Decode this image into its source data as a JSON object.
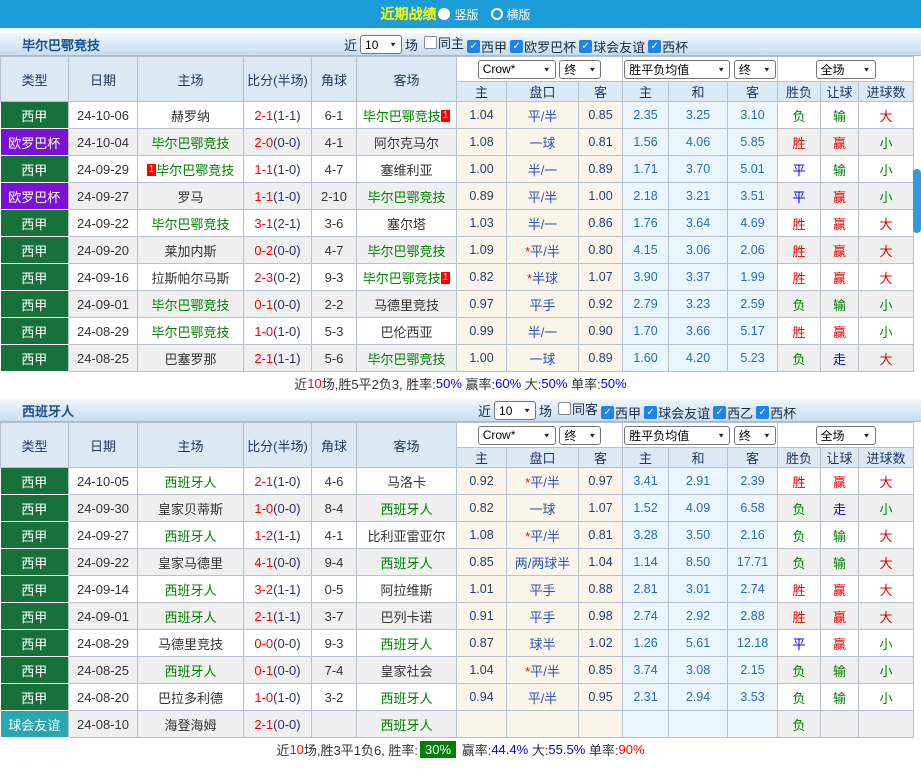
{
  "topbar": {
    "title": "近期战绩",
    "vertical_label": "竖版",
    "horizontal_label": "横版"
  },
  "columns": {
    "type": "类型",
    "date": "日期",
    "home": "主场",
    "score": "比分(半场)",
    "corner": "角球",
    "away": "客场",
    "odds_home": "主",
    "handicap": "盘口",
    "odds_away": "客",
    "mean_home": "主",
    "mean_draw": "和",
    "mean_away": "客",
    "result": "胜负",
    "handicap_result": "让球",
    "goals": "进球数"
  },
  "colors": {
    "topbar": "#1d9cd8",
    "types": {
      "西甲": "#17713a",
      "欧罗巴杯": "#7a12d4",
      "球会友谊": "#29a7ae"
    },
    "focus_team": "#008000",
    "score": "#ff0000",
    "result_map": {
      "胜": "#e60000",
      "负": "#008000",
      "平": "#0000e6",
      "赢": "#e60000",
      "输": "#008000",
      "走": "#0000e6",
      "大": "#e60000",
      "小": "#008000"
    }
  },
  "sections": [
    {
      "team": "毕尔巴鄂竞技",
      "filter": {
        "near_label": "近",
        "games": "10",
        "games_label": "场",
        "checkboxes": [
          {
            "label": "同主",
            "checked": false
          },
          {
            "label": "西甲",
            "checked": true
          },
          {
            "label": "欧罗巴杯",
            "checked": true
          },
          {
            "label": "球会友谊",
            "checked": true
          },
          {
            "label": "西杯",
            "checked": true
          }
        ]
      },
      "selects": {
        "odds": "Crow*",
        "odds_state": "终",
        "mean": "胜平负均值",
        "mean_state": "终",
        "scope": "全场"
      },
      "rows": [
        {
          "type": "西甲",
          "date": "24-10-06",
          "home": {
            "name": "赫罗纳",
            "focus": false
          },
          "score": "2-1",
          "half": "(1-1)",
          "corner": "6-1",
          "away": {
            "name": "毕尔巴鄂竞技",
            "focus": true,
            "badge_right": "1"
          },
          "odds": [
            "1.04",
            "平/半",
            "0.85"
          ],
          "mean": [
            "2.35",
            "3.25",
            "3.10"
          ],
          "results": [
            "负",
            "输",
            "大"
          ]
        },
        {
          "type": "欧罗巴杯",
          "date": "24-10-04",
          "home": {
            "name": "毕尔巴鄂竞技",
            "focus": true
          },
          "score": "2-0",
          "half": "(0-0)",
          "corner": "4-1",
          "away": {
            "name": "阿尔克马尔",
            "focus": false
          },
          "odds": [
            "1.08",
            "一球",
            "0.81"
          ],
          "mean": [
            "1.56",
            "4.06",
            "5.85"
          ],
          "results": [
            "胜",
            "赢",
            "小"
          ]
        },
        {
          "type": "西甲",
          "date": "24-09-29",
          "home": {
            "name": "毕尔巴鄂竞技",
            "focus": true,
            "badge_left": "1"
          },
          "score": "1-1",
          "half": "(1-0)",
          "corner": "4-7",
          "away": {
            "name": "塞维利亚",
            "focus": false
          },
          "odds": [
            "1.00",
            "半/一",
            "0.89"
          ],
          "mean": [
            "1.71",
            "3.70",
            "5.01"
          ],
          "results": [
            "平",
            "输",
            "小"
          ]
        },
        {
          "type": "欧罗巴杯",
          "date": "24-09-27",
          "home": {
            "name": "罗马",
            "focus": false
          },
          "score": "1-1",
          "half": "(1-0)",
          "corner": "2-10",
          "away": {
            "name": "毕尔巴鄂竞技",
            "focus": true
          },
          "odds": [
            "0.89",
            "平/半",
            "1.00"
          ],
          "mean": [
            "2.18",
            "3.21",
            "3.51"
          ],
          "results": [
            "平",
            "赢",
            "小"
          ]
        },
        {
          "type": "西甲",
          "date": "24-09-22",
          "home": {
            "name": "毕尔巴鄂竞技",
            "focus": true
          },
          "score": "3-1",
          "half": "(2-1)",
          "corner": "3-6",
          "away": {
            "name": "塞尔塔",
            "focus": false
          },
          "odds": [
            "1.03",
            "半/一",
            "0.86"
          ],
          "mean": [
            "1.76",
            "3.64",
            "4.69"
          ],
          "results": [
            "胜",
            "赢",
            "大"
          ]
        },
        {
          "type": "西甲",
          "date": "24-09-20",
          "home": {
            "name": "莱加内斯",
            "focus": false
          },
          "score": "0-2",
          "half": "(0-0)",
          "corner": "4-7",
          "away": {
            "name": "毕尔巴鄂竞技",
            "focus": true
          },
          "odds": [
            "1.09",
            "*平/半",
            "0.80"
          ],
          "mean": [
            "4.15",
            "3.06",
            "2.06"
          ],
          "results": [
            "胜",
            "赢",
            "大"
          ]
        },
        {
          "type": "西甲",
          "date": "24-09-16",
          "home": {
            "name": "拉斯帕尔马斯",
            "focus": false
          },
          "score": "2-3",
          "half": "(0-2)",
          "corner": "9-3",
          "away": {
            "name": "毕尔巴鄂竞技",
            "focus": true,
            "badge_right": "1"
          },
          "odds": [
            "0.82",
            "*半球",
            "1.07"
          ],
          "mean": [
            "3.90",
            "3.37",
            "1.99"
          ],
          "results": [
            "胜",
            "赢",
            "大"
          ]
        },
        {
          "type": "西甲",
          "date": "24-09-01",
          "home": {
            "name": "毕尔巴鄂竞技",
            "focus": true
          },
          "score": "0-1",
          "half": "(0-0)",
          "corner": "2-2",
          "away": {
            "name": "马德里竞技",
            "focus": false
          },
          "odds": [
            "0.97",
            "平手",
            "0.92"
          ],
          "mean": [
            "2.79",
            "3.23",
            "2.59"
          ],
          "results": [
            "负",
            "输",
            "小"
          ]
        },
        {
          "type": "西甲",
          "date": "24-08-29",
          "home": {
            "name": "毕尔巴鄂竞技",
            "focus": true
          },
          "score": "1-0",
          "half": "(1-0)",
          "corner": "5-3",
          "away": {
            "name": "巴伦西亚",
            "focus": false
          },
          "odds": [
            "0.99",
            "半/一",
            "0.90"
          ],
          "mean": [
            "1.70",
            "3.66",
            "5.17"
          ],
          "results": [
            "胜",
            "赢",
            "小"
          ]
        },
        {
          "type": "西甲",
          "date": "24-08-25",
          "home": {
            "name": "巴塞罗那",
            "focus": false
          },
          "score": "2-1",
          "half": "(1-1)",
          "corner": "5-6",
          "away": {
            "name": "毕尔巴鄂竞技",
            "focus": true
          },
          "odds": [
            "1.00",
            "一球",
            "0.89"
          ],
          "mean": [
            "1.60",
            "4.20",
            "5.23"
          ],
          "results": [
            "负",
            "走",
            "大"
          ]
        }
      ],
      "summary": [
        {
          "text": "近",
          "color": "#333333"
        },
        {
          "text": "10",
          "color": "#ff0000"
        },
        {
          "text": "场,胜5平2负3, 胜率:",
          "color": "#333333"
        },
        {
          "text": "50%",
          "color": "#0000ee"
        },
        {
          "text": " 赢率:",
          "color": "#333333"
        },
        {
          "text": "60%",
          "color": "#0000ee"
        },
        {
          "text": " 大:",
          "color": "#333333"
        },
        {
          "text": "50%",
          "color": "#0000ee"
        },
        {
          "text": " 单率:",
          "color": "#333333"
        },
        {
          "text": "50%",
          "color": "#0000ee"
        }
      ]
    },
    {
      "team": "西班牙人",
      "filter": {
        "near_label": "近",
        "games": "10",
        "games_label": "场",
        "checkboxes": [
          {
            "label": "同客",
            "checked": false
          },
          {
            "label": "西甲",
            "checked": true
          },
          {
            "label": "球会友谊",
            "checked": true
          },
          {
            "label": "西乙",
            "checked": true
          },
          {
            "label": "西杯",
            "checked": true
          }
        ]
      },
      "selects": {
        "odds": "Crow*",
        "odds_state": "终",
        "mean": "胜平负均值",
        "mean_state": "终",
        "scope": "全场"
      },
      "rows": [
        {
          "type": "西甲",
          "date": "24-10-05",
          "home": {
            "name": "西班牙人",
            "focus": true
          },
          "score": "2-1",
          "half": "(1-0)",
          "corner": "4-6",
          "away": {
            "name": "马洛卡",
            "focus": false
          },
          "odds": [
            "0.92",
            "*平/半",
            "0.97"
          ],
          "mean": [
            "3.41",
            "2.91",
            "2.39"
          ],
          "results": [
            "胜",
            "赢",
            "大"
          ]
        },
        {
          "type": "西甲",
          "date": "24-09-30",
          "home": {
            "name": "皇家贝蒂斯",
            "focus": false
          },
          "score": "1-0",
          "half": "(0-0)",
          "corner": "8-4",
          "away": {
            "name": "西班牙人",
            "focus": true
          },
          "odds": [
            "0.82",
            "一球",
            "1.07"
          ],
          "mean": [
            "1.52",
            "4.09",
            "6.58"
          ],
          "results": [
            "负",
            "走",
            "小"
          ]
        },
        {
          "type": "西甲",
          "date": "24-09-27",
          "home": {
            "name": "西班牙人",
            "focus": true
          },
          "score": "1-2",
          "half": "(1-1)",
          "corner": "4-1",
          "away": {
            "name": "比利亚雷亚尔",
            "focus": false
          },
          "odds": [
            "1.08",
            "*平/半",
            "0.81"
          ],
          "mean": [
            "3.28",
            "3.50",
            "2.16"
          ],
          "results": [
            "负",
            "输",
            "大"
          ]
        },
        {
          "type": "西甲",
          "date": "24-09-22",
          "home": {
            "name": "皇家马德里",
            "focus": false
          },
          "score": "4-1",
          "half": "(0-0)",
          "corner": "9-4",
          "away": {
            "name": "西班牙人",
            "focus": true
          },
          "odds": [
            "0.85",
            "两/两球半",
            "1.04"
          ],
          "mean": [
            "1.14",
            "8.50",
            "17.71"
          ],
          "results": [
            "负",
            "输",
            "大"
          ]
        },
        {
          "type": "西甲",
          "date": "24-09-14",
          "home": {
            "name": "西班牙人",
            "focus": true
          },
          "score": "3-2",
          "half": "(1-1)",
          "corner": "0-5",
          "away": {
            "name": "阿拉维斯",
            "focus": false
          },
          "odds": [
            "1.01",
            "平手",
            "0.88"
          ],
          "mean": [
            "2.81",
            "3.01",
            "2.74"
          ],
          "results": [
            "胜",
            "赢",
            "大"
          ]
        },
        {
          "type": "西甲",
          "date": "24-09-01",
          "home": {
            "name": "西班牙人",
            "focus": true
          },
          "score": "2-1",
          "half": "(1-1)",
          "corner": "3-7",
          "away": {
            "name": "巴列卡诺",
            "focus": false
          },
          "odds": [
            "0.91",
            "平手",
            "0.98"
          ],
          "mean": [
            "2.74",
            "2.92",
            "2.88"
          ],
          "results": [
            "胜",
            "赢",
            "大"
          ]
        },
        {
          "type": "西甲",
          "date": "24-08-29",
          "home": {
            "name": "马德里竞技",
            "focus": false
          },
          "score": "0-0",
          "half": "(0-0)",
          "corner": "9-3",
          "away": {
            "name": "西班牙人",
            "focus": true
          },
          "odds": [
            "0.87",
            "球半",
            "1.02"
          ],
          "mean": [
            "1.26",
            "5.61",
            "12.18"
          ],
          "results": [
            "平",
            "赢",
            "小"
          ]
        },
        {
          "type": "西甲",
          "date": "24-08-25",
          "home": {
            "name": "西班牙人",
            "focus": true
          },
          "score": "0-1",
          "half": "(0-0)",
          "corner": "7-4",
          "away": {
            "name": "皇家社会",
            "focus": false
          },
          "odds": [
            "1.04",
            "*平/半",
            "0.85"
          ],
          "mean": [
            "3.74",
            "3.08",
            "2.15"
          ],
          "results": [
            "负",
            "输",
            "小"
          ]
        },
        {
          "type": "西甲",
          "date": "24-08-20",
          "home": {
            "name": "巴拉多利德",
            "focus": false
          },
          "score": "1-0",
          "half": "(1-0)",
          "corner": "3-2",
          "away": {
            "name": "西班牙人",
            "focus": true
          },
          "odds": [
            "0.94",
            "平/半",
            "0.95"
          ],
          "mean": [
            "2.31",
            "2.94",
            "3.53"
          ],
          "results": [
            "负",
            "输",
            "小"
          ]
        },
        {
          "type": "球会友谊",
          "date": "24-08-10",
          "home": {
            "name": "海登海姆",
            "focus": false
          },
          "score": "2-1",
          "half": "(0-0)",
          "corner": "",
          "away": {
            "name": "西班牙人",
            "focus": true
          },
          "odds": [
            "",
            "",
            ""
          ],
          "mean": [
            "",
            "",
            ""
          ],
          "results": [
            "负",
            "",
            ""
          ]
        }
      ],
      "summary": [
        {
          "text": "近",
          "color": "#333333"
        },
        {
          "text": "10",
          "color": "#ff0000"
        },
        {
          "text": "场,胜3平1负6, 胜率:",
          "color": "#333333"
        },
        {
          "text": "30%",
          "color": "#ffffff",
          "badge": true
        },
        {
          "text": " 赢率:",
          "color": "#333333"
        },
        {
          "text": "44.4%",
          "color": "#0000ee"
        },
        {
          "text": " 大:",
          "color": "#333333"
        },
        {
          "text": "55.5%",
          "color": "#0000ee"
        },
        {
          "text": " 单率:",
          "color": "#333333"
        },
        {
          "text": "90%",
          "color": "#ff0000"
        }
      ]
    }
  ]
}
